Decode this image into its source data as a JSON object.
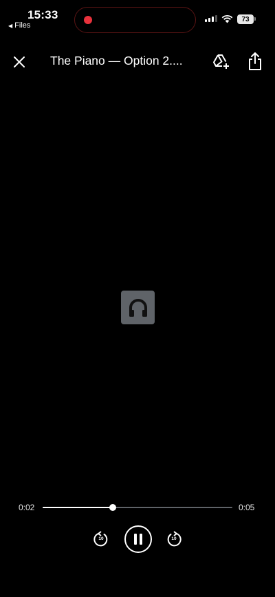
{
  "status_bar": {
    "time": "15:33",
    "back_app": "Files",
    "battery": "73",
    "recording_color": "#e8323c"
  },
  "player": {
    "title": "The Piano — Option 2....",
    "close_icon": "close-icon",
    "drive_icon": "add-to-drive-icon",
    "share_icon": "share-icon",
    "art_icon": "headphones-icon",
    "current_time": "0:02",
    "total_time": "0:05",
    "progress": 0.37,
    "rewind_seconds": "10",
    "forward_seconds": "10",
    "state": "playing"
  }
}
